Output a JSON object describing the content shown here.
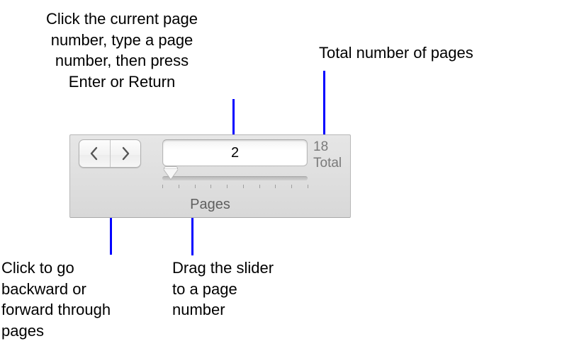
{
  "callouts": {
    "page_input": "Click the current page\nnumber, type a page\nnumber, then press\nEnter or Return",
    "total": "Total number of pages",
    "nav": "Click to go\nbackward or\nforward through\npages",
    "slider": "Drag the slider\nto a page\nnumber"
  },
  "panel": {
    "current_page": "2",
    "total_pages": "18",
    "total_label": "Total",
    "title": "Pages"
  },
  "slider": {
    "min": 1,
    "max": 18,
    "value": 2,
    "tick_count": 10
  }
}
